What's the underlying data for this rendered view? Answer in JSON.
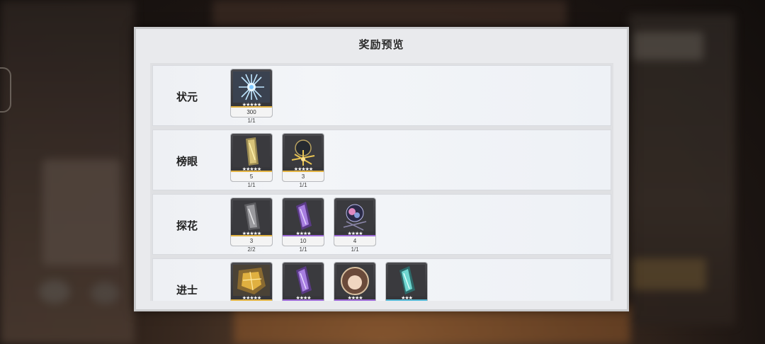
{
  "modal": {
    "title": "奖励预览"
  },
  "colors": {
    "gold": "#e3b443",
    "purple": "#9d6ad8",
    "blue": "#55b9d6"
  },
  "tiers": [
    {
      "label": "状元",
      "items": [
        {
          "icon": "blue-crystal-icon",
          "stars": "★★★★★",
          "qty": "300",
          "count": "1/1",
          "rarity": "gold"
        }
      ]
    },
    {
      "label": "榜眼",
      "items": [
        {
          "icon": "gold-cylinder-icon",
          "stars": "★★★★★",
          "qty": "5",
          "count": "1/1",
          "rarity": "gold"
        },
        {
          "icon": "gold-orb-icon",
          "stars": "★★★★★",
          "qty": "3",
          "count": "1/1",
          "rarity": "gold"
        }
      ]
    },
    {
      "label": "探花",
      "items": [
        {
          "icon": "silver-cylinder-icon",
          "stars": "★★★★★",
          "qty": "3",
          "count": "2/2",
          "rarity": "gold"
        },
        {
          "icon": "purple-cylinder-icon",
          "stars": "★★★★",
          "qty": "10",
          "count": "1/1",
          "rarity": "purple"
        },
        {
          "icon": "purple-orb-icon",
          "stars": "★★★★",
          "qty": "4",
          "count": "1/1",
          "rarity": "purple"
        }
      ]
    },
    {
      "label": "进士",
      "items": [
        {
          "icon": "gold-fragment-icon",
          "stars": "★★★★★",
          "qty": "",
          "count": "",
          "rarity": "gold"
        },
        {
          "icon": "purple-cylinder-icon",
          "stars": "★★★★",
          "qty": "",
          "count": "",
          "rarity": "purple"
        },
        {
          "icon": "character-portrait-icon",
          "stars": "★★★★",
          "qty": "",
          "count": "",
          "rarity": "purple"
        },
        {
          "icon": "teal-cylinder-icon",
          "stars": "★★★",
          "qty": "",
          "count": "",
          "rarity": "blue"
        }
      ]
    }
  ]
}
